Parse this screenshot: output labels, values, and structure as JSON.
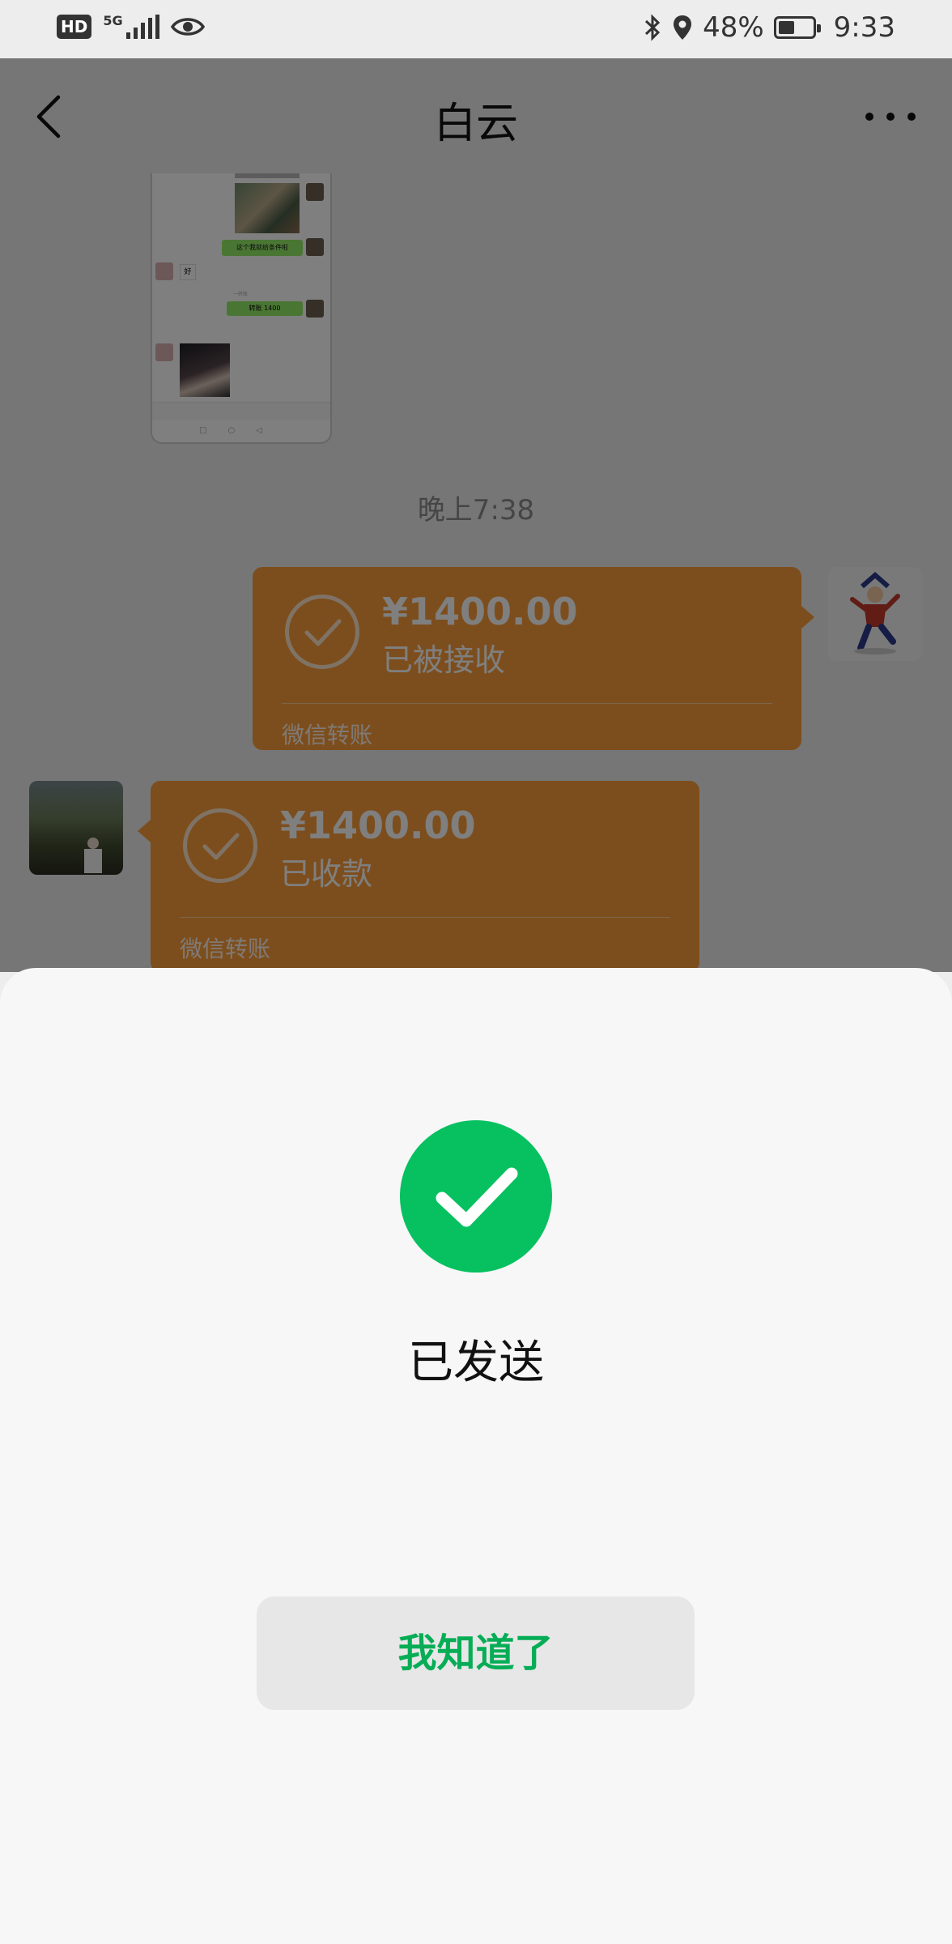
{
  "status_bar": {
    "hd": "HD",
    "network": "5G",
    "battery": "48%",
    "battery_level": 0.48,
    "time": "9:33",
    "icons": [
      "eye-icon",
      "bluetooth-icon",
      "location-icon",
      "battery-icon"
    ]
  },
  "nav": {
    "title": "白云",
    "icons": [
      "back-chevron-icon",
      "more-dots-icon"
    ]
  },
  "chat": {
    "timestamp": "晚上7:38",
    "screenshot_thumb": {
      "bubble_1": "这个我就给条件啦",
      "bubble_2": "好",
      "bubble_3": "转账 1400",
      "sub_label": "一转账"
    },
    "transfers": [
      {
        "amount": "¥1400.00",
        "status": "已被接收",
        "footer": "微信转账",
        "side": "outgoing"
      },
      {
        "amount": "¥1400.00",
        "status": "已收款",
        "footer": "微信转账",
        "side": "incoming"
      }
    ]
  },
  "sheet": {
    "title": "已发送",
    "button_label": "我知道了",
    "colors": {
      "success": "#07c160",
      "button_text": "#06ad56"
    }
  }
}
